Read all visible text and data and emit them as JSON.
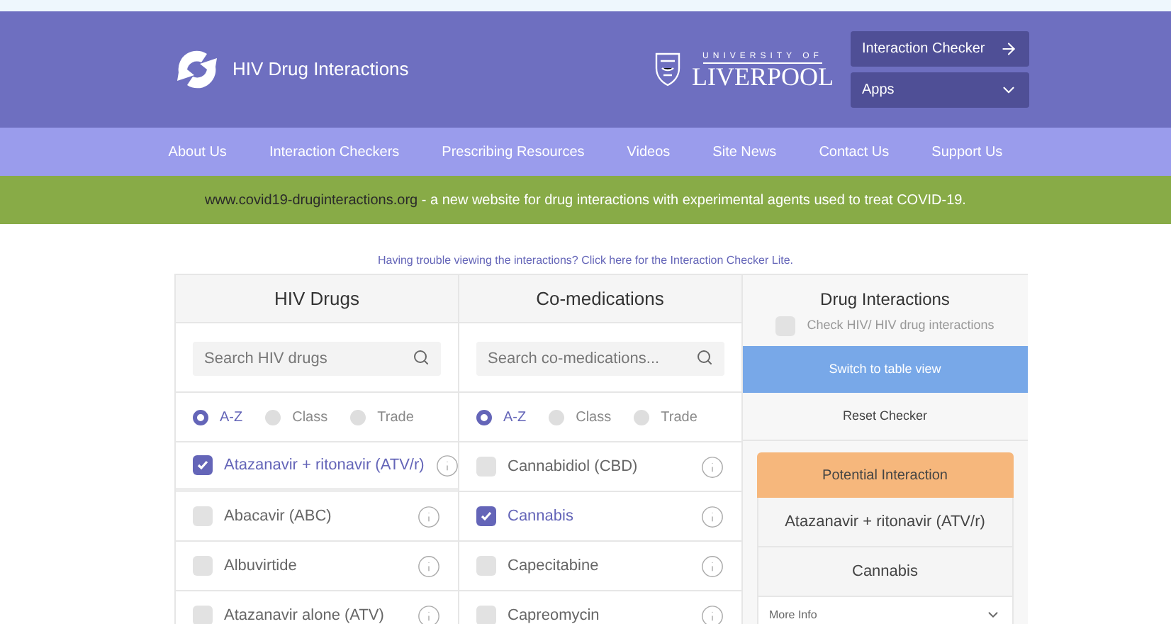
{
  "header": {
    "site_title": "HIV Drug Interactions",
    "university": {
      "line_1": "UNIVERSITY OF",
      "line_2": "LIVERPOOL"
    },
    "buttons": [
      {
        "label": "Interaction Checker",
        "kind": "arrow"
      },
      {
        "label": "Apps",
        "kind": "dropdown"
      }
    ]
  },
  "nav": {
    "items": [
      "About Us",
      "Interaction Checkers",
      "Prescribing Resources",
      "Videos",
      "Site News",
      "Contact Us",
      "Support Us"
    ]
  },
  "banner": {
    "link": "www.covid19-druginteractions.org",
    "text": " - a new website for drug interactions with experimental agents used to treat COVID-19."
  },
  "lite_link": "Having trouble viewing the interactions? Click here for the Interaction Checker Lite.",
  "columns": [
    {
      "title": "HIV Drugs",
      "search": {
        "placeholder": "Search HIV drugs"
      },
      "sort": [
        {
          "label": "A-Z",
          "selected": true
        },
        {
          "label": "Class",
          "selected": false
        },
        {
          "label": "Trade",
          "selected": false
        }
      ],
      "items": [
        {
          "name": "Atazanavir + ritonavir (ATV/r)",
          "checked": true
        },
        {
          "name": "Abacavir (ABC)",
          "checked": false
        },
        {
          "name": "Albuvirtide",
          "checked": false
        },
        {
          "name": "Atazanavir alone (ATV)",
          "checked": false
        }
      ]
    },
    {
      "title": "Co-medications",
      "search": {
        "placeholder": "Search co-medications..."
      },
      "sort": [
        {
          "label": "A-Z",
          "selected": true
        },
        {
          "label": "Class",
          "selected": false
        },
        {
          "label": "Trade",
          "selected": false
        }
      ],
      "items": [
        {
          "name": "Cannabidiol (CBD)",
          "checked": false
        },
        {
          "name": "Cannabis",
          "checked": true
        },
        {
          "name": "Capecitabine",
          "checked": false
        },
        {
          "name": "Capreomycin",
          "checked": false
        }
      ]
    }
  ],
  "interactions": {
    "title": "Drug Interactions",
    "hiv_hiv_check": {
      "label": "Check HIV/ HIV drug interactions",
      "checked": false
    },
    "switch_button": "Switch to table view",
    "reset_button": "Reset Checker",
    "result": {
      "status": "Potential Interaction",
      "color": "#f6b77c",
      "drugs": [
        "Atazanavir + ritonavir (ATV/r)",
        "Cannabis"
      ],
      "more_info": "More Info"
    }
  }
}
